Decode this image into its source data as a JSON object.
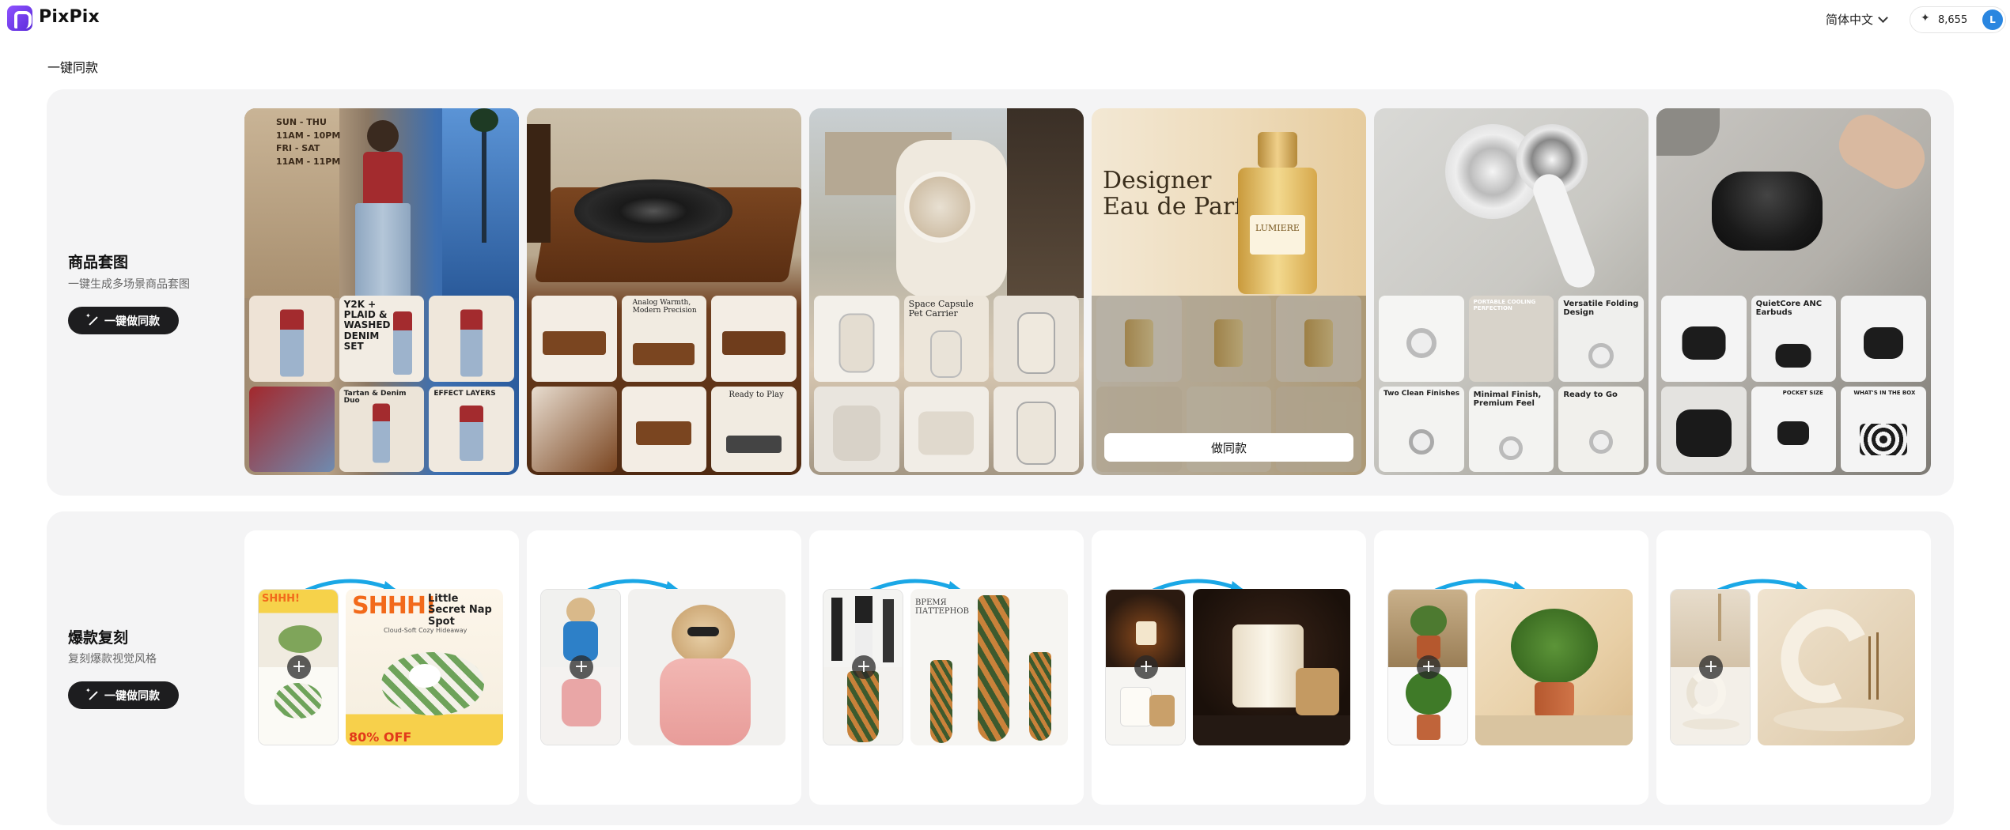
{
  "app": {
    "name": "PixPix"
  },
  "header": {
    "language": "简体中文",
    "credits": "8,655",
    "avatar_initial": "L"
  },
  "page_title": "一键同款",
  "product_set": {
    "title": "商品套图",
    "subtitle": "一键生成多场景商品套图",
    "button": "一键做同款",
    "hover_button": "做同款",
    "cards": [
      {
        "hero_sign": "SUN - THU\n11AM - 10PM\nFRI - SAT\n11AM - 11PM",
        "tiles": [
          "",
          "Y2K + PLAID & WASHED DENIM SET",
          "",
          "",
          "Tartan & Denim Duo",
          "EFFECT LAYERS"
        ]
      },
      {
        "tiles": [
          "",
          "Analog Warmth, Modern Precision",
          "",
          "",
          "",
          "Ready to Play"
        ]
      },
      {
        "tiles": [
          "",
          "Space Capsule Pet Carrier",
          "",
          "",
          "",
          ""
        ]
      },
      {
        "hero_title": "Designer\nEau de Parfum",
        "bottle_label": "LUMIERE",
        "tiles": [
          "",
          "",
          "",
          "",
          "",
          ""
        ]
      },
      {
        "tiles": [
          "",
          "PORTABLE COOLING PERFECTION",
          "Versatile Folding Design",
          "Two Clean Finishes",
          "Minimal Finish, Premium Feel",
          "Ready to Go"
        ]
      },
      {
        "tiles": [
          "",
          "QuietCore ANC Earbuds",
          "",
          "",
          "POCKET SIZE",
          "WHAT'S IN THE BOX"
        ]
      }
    ]
  },
  "viral_replica": {
    "title": "爆款复刻",
    "subtitle": "复刻爆款视觉风格",
    "button": "一键做同款",
    "cards": [
      {
        "big_heading": "SHHH!",
        "big_sub": "Little Secret Nap Spot",
        "big_tag": "Cloud-Soft Cozy Hideaway",
        "big_footer": "80% OFF"
      },
      {
        "big_heading": ""
      },
      {
        "big_heading": "ВРЕМЯ ПАТТЕРНОВ"
      },
      {
        "big_heading": ""
      },
      {
        "big_heading": ""
      },
      {
        "big_heading": ""
      }
    ]
  },
  "icons": [
    "logo-icon",
    "chevron-down-icon",
    "sparkle-icon",
    "magic-wand-icon",
    "plus-icon",
    "arrow-icon"
  ],
  "colors": {
    "accent": "#6a35e8",
    "button_dark": "#1d1d1f",
    "section_bg": "#f4f4f5",
    "arrow_blue": "#1aa7e6",
    "avatar_blue": "#2a86e0"
  }
}
